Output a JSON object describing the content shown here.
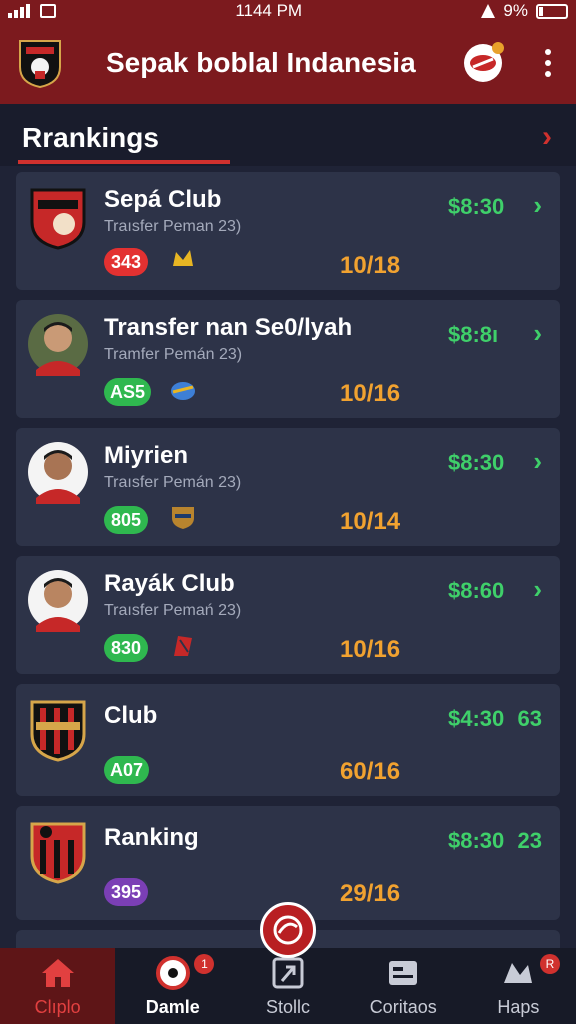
{
  "status": {
    "time": "1144 PM",
    "battery": "9%"
  },
  "app_bar": {
    "title": "Sepak boblal Indanesia"
  },
  "section": {
    "title": "Rrankings"
  },
  "cards": [
    {
      "name": "Sepá Club",
      "sub": "Traısfer Peman 23)",
      "price": "$8:30",
      "pill": "343",
      "pill_color": "#e33131",
      "score": "10/18",
      "trail": ">"
    },
    {
      "name": "Transfer nan Se0/lyah",
      "sub": "Tramfer Pemán 23)",
      "price": "$8:8ı",
      "pill": "AS5",
      "pill_color": "#2fb84f",
      "score": "10/16",
      "trail": ">"
    },
    {
      "name": "Miyrien",
      "sub": "Traısfer Pemán 23)",
      "price": "$8:30",
      "pill": "805",
      "pill_color": "#2fb84f",
      "score": "10/14",
      "trail": ">"
    },
    {
      "name": "Rayák Club",
      "sub": "Traısfer Pemań 23)",
      "price": "$8:60",
      "pill": "830",
      "pill_color": "#2fb84f",
      "score": "10/16",
      "trail": ">"
    },
    {
      "name": "Club",
      "sub": "",
      "price": "$4:30",
      "pill": "A07",
      "pill_color": "#2fb84f",
      "score": "60/16",
      "trail": "63"
    },
    {
      "name": "Ranking",
      "sub": "",
      "price": "$8:30",
      "pill": "395",
      "pill_color": "#7b3fb5",
      "score": "29/16",
      "trail": "23"
    }
  ],
  "nav": {
    "items": [
      {
        "label": "Clıplo"
      },
      {
        "label": "Damle",
        "badge": "1"
      },
      {
        "label": "Stollc"
      },
      {
        "label": "Coritaos"
      },
      {
        "label": "Haps",
        "badge": "R"
      }
    ]
  },
  "icons": {
    "logo": "club-crest-icon",
    "badge": "club-badge-icon",
    "menu": "kebab-menu-icon",
    "fab": "swirl-icon"
  },
  "colors": {
    "brand": "#7c1a1e",
    "accent": "#d0312e",
    "price": "#3fd06a",
    "score": "#f1a230",
    "background": "#1f2336",
    "card": "#2d3348"
  }
}
